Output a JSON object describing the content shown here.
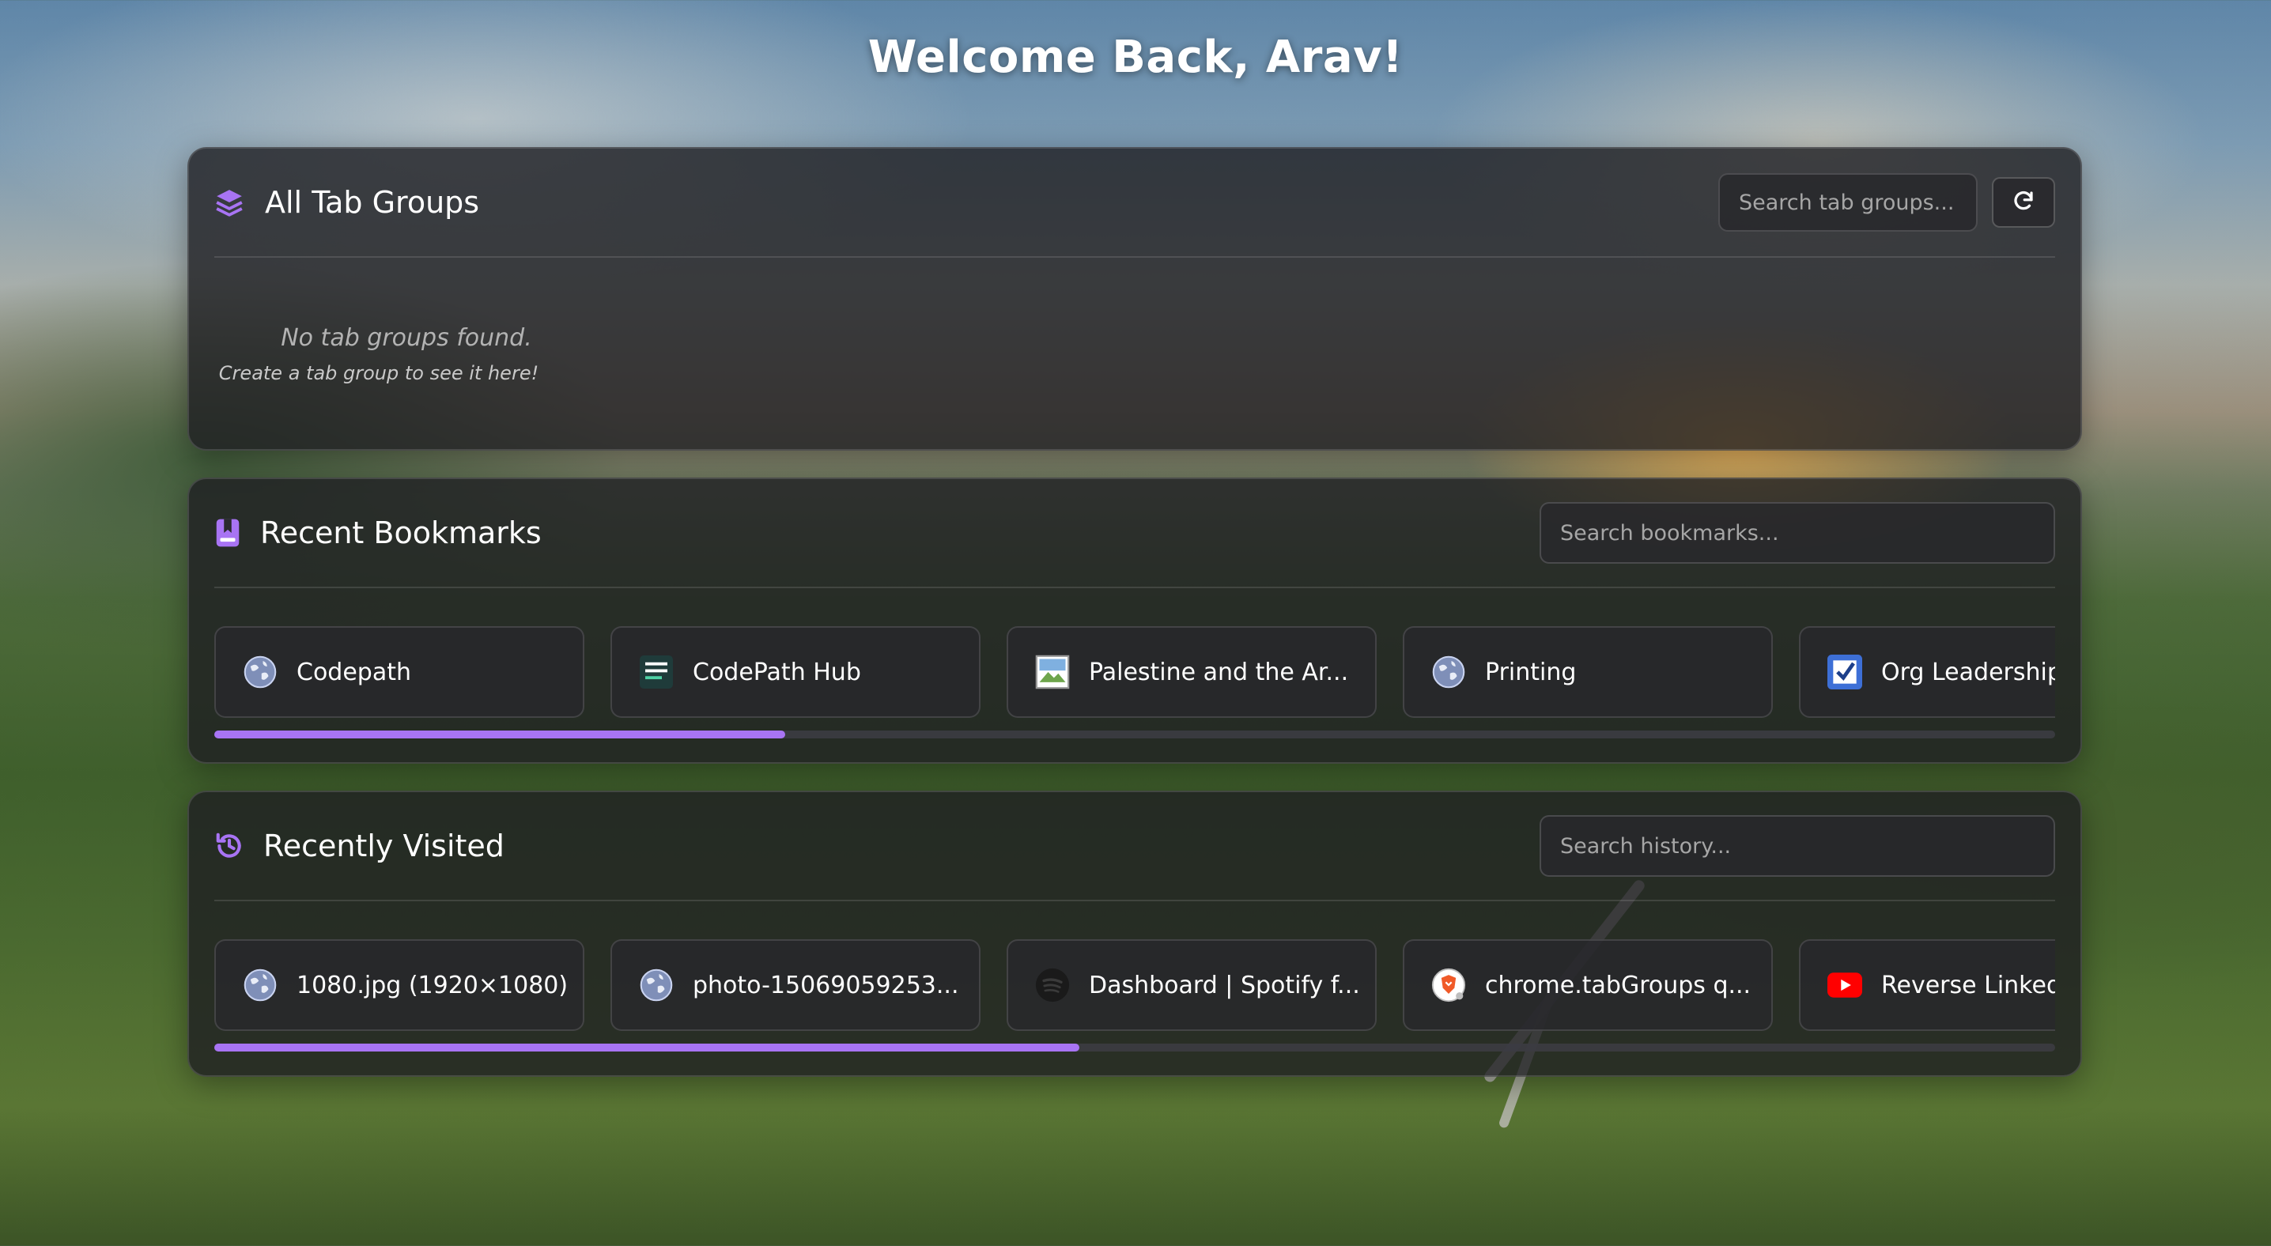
{
  "greeting": "Welcome Back, Arav!",
  "accent_color": "#a874f4",
  "tab_groups": {
    "title": "All Tab Groups",
    "icon": "layers-icon",
    "search_placeholder": "Search tab groups...",
    "refresh_icon": "refresh-icon",
    "empty_title": "No tab groups found.",
    "empty_subtitle": "Create a tab group to see it here!"
  },
  "bookmarks": {
    "title": "Recent Bookmarks",
    "icon": "bookmark-icon",
    "search_placeholder": "Search bookmarks...",
    "scroll_fraction": 0.31,
    "items": [
      {
        "label": "Codepath",
        "icon": "globe-icon"
      },
      {
        "label": "CodePath Hub",
        "icon": "codepath-logo-icon"
      },
      {
        "label": "Palestine and the Ar...",
        "icon": "broken-image-icon"
      },
      {
        "label": "Printing",
        "icon": "globe-icon"
      },
      {
        "label": "Org Leadership",
        "icon": "checkbox-logo-icon"
      }
    ]
  },
  "history": {
    "title": "Recently Visited",
    "icon": "history-icon",
    "search_placeholder": "Search history...",
    "scroll_fraction": 0.47,
    "items": [
      {
        "label": "1080.jpg (1920×1080)",
        "icon": "globe-icon"
      },
      {
        "label": "photo-15069059253...",
        "icon": "globe-icon"
      },
      {
        "label": "Dashboard | Spotify f...",
        "icon": "spotify-icon"
      },
      {
        "label": "chrome.tabGroups q...",
        "icon": "brave-icon"
      },
      {
        "label": "Reverse Linked L",
        "icon": "youtube-icon"
      }
    ]
  }
}
